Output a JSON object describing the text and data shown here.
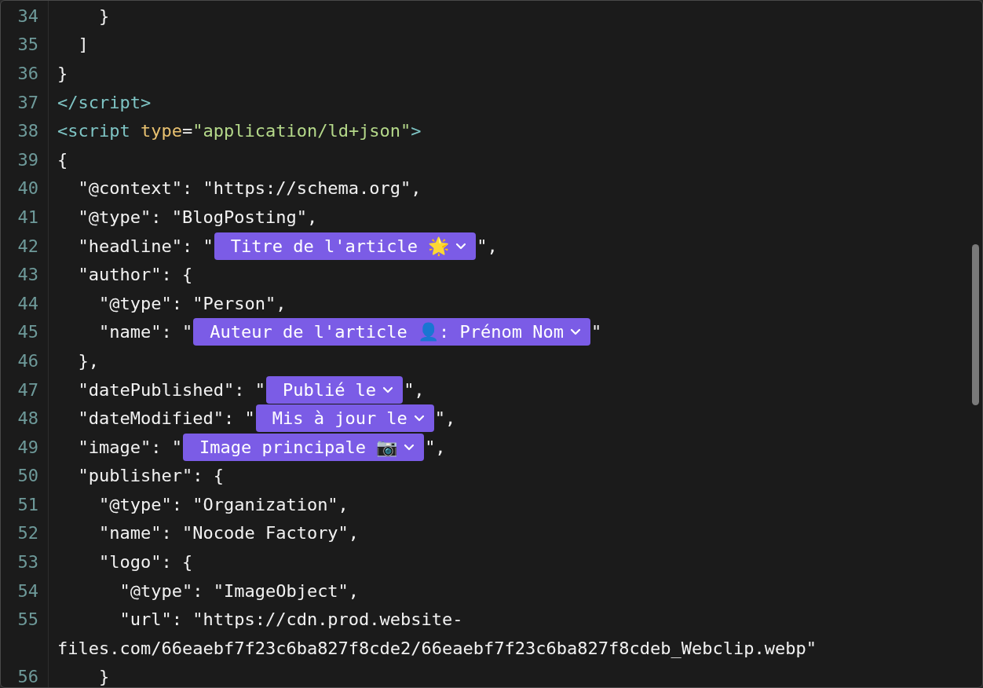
{
  "editor": {
    "lines": [
      {
        "number": "34",
        "segments": [
          {
            "kind": "plain",
            "text": "    }"
          }
        ]
      },
      {
        "number": "35",
        "segments": [
          {
            "kind": "plain",
            "text": "  ]"
          }
        ]
      },
      {
        "number": "36",
        "segments": [
          {
            "kind": "plain",
            "text": "}"
          }
        ]
      },
      {
        "number": "37",
        "segments": [
          {
            "kind": "tag",
            "text": "</script>"
          }
        ]
      },
      {
        "number": "38",
        "segments": [
          {
            "kind": "tag",
            "text": "<script"
          },
          {
            "kind": "attr",
            "text": " type"
          },
          {
            "kind": "plain",
            "text": "="
          },
          {
            "kind": "string",
            "text": "\"application/ld+json\""
          },
          {
            "kind": "tag",
            "text": ">"
          }
        ]
      },
      {
        "number": "39",
        "segments": [
          {
            "kind": "plain",
            "text": "{"
          }
        ]
      },
      {
        "number": "40",
        "segments": [
          {
            "kind": "plain",
            "text": "  \"@context\": \"https://schema.org\","
          }
        ]
      },
      {
        "number": "41",
        "segments": [
          {
            "kind": "plain",
            "text": "  \"@type\": \"BlogPosting\","
          }
        ]
      },
      {
        "number": "42",
        "segments": [
          {
            "kind": "plain",
            "text": "  \"headline\": \""
          },
          {
            "kind": "chip",
            "text": "Titre de l'article 🌟"
          },
          {
            "kind": "plain",
            "text": "\","
          }
        ]
      },
      {
        "number": "43",
        "segments": [
          {
            "kind": "plain",
            "text": "  \"author\": {"
          }
        ]
      },
      {
        "number": "44",
        "segments": [
          {
            "kind": "plain",
            "text": "    \"@type\": \"Person\","
          }
        ]
      },
      {
        "number": "45",
        "segments": [
          {
            "kind": "plain",
            "text": "    \"name\": \""
          },
          {
            "kind": "chip",
            "text": "Auteur de l'article 👤: Prénom Nom"
          },
          {
            "kind": "plain",
            "text": "\""
          }
        ]
      },
      {
        "number": "46",
        "segments": [
          {
            "kind": "plain",
            "text": "  },"
          }
        ]
      },
      {
        "number": "47",
        "segments": [
          {
            "kind": "plain",
            "text": "  \"datePublished\": \""
          },
          {
            "kind": "chip",
            "text": "Publié le"
          },
          {
            "kind": "plain",
            "text": "\","
          }
        ]
      },
      {
        "number": "48",
        "segments": [
          {
            "kind": "plain",
            "text": "  \"dateModified\": \""
          },
          {
            "kind": "chip",
            "text": "Mis à jour le"
          },
          {
            "kind": "plain",
            "text": "\","
          }
        ]
      },
      {
        "number": "49",
        "segments": [
          {
            "kind": "plain",
            "text": "  \"image\": \""
          },
          {
            "kind": "chip",
            "text": "Image principale 📷"
          },
          {
            "kind": "plain",
            "text": "\","
          }
        ]
      },
      {
        "number": "50",
        "segments": [
          {
            "kind": "plain",
            "text": "  \"publisher\": {"
          }
        ]
      },
      {
        "number": "51",
        "segments": [
          {
            "kind": "plain",
            "text": "    \"@type\": \"Organization\","
          }
        ]
      },
      {
        "number": "52",
        "segments": [
          {
            "kind": "plain",
            "text": "    \"name\": \"Nocode Factory\","
          }
        ]
      },
      {
        "number": "53",
        "segments": [
          {
            "kind": "plain",
            "text": "    \"logo\": {"
          }
        ]
      },
      {
        "number": "54",
        "segments": [
          {
            "kind": "plain",
            "text": "      \"@type\": \"ImageObject\","
          }
        ]
      },
      {
        "number": "55",
        "segments": [
          {
            "kind": "plain",
            "text": "      \"url\": \"https://cdn.prod.website-"
          }
        ]
      },
      {
        "segments": [
          {
            "kind": "plain",
            "text": "files.com/66eaebf7f23c6ba827f8cde2/66eaebf7f23c6ba827f8cdeb_Webclip.webp\""
          }
        ]
      },
      {
        "number": "56",
        "segments": [
          {
            "kind": "plain",
            "text": "    }"
          }
        ]
      }
    ]
  }
}
